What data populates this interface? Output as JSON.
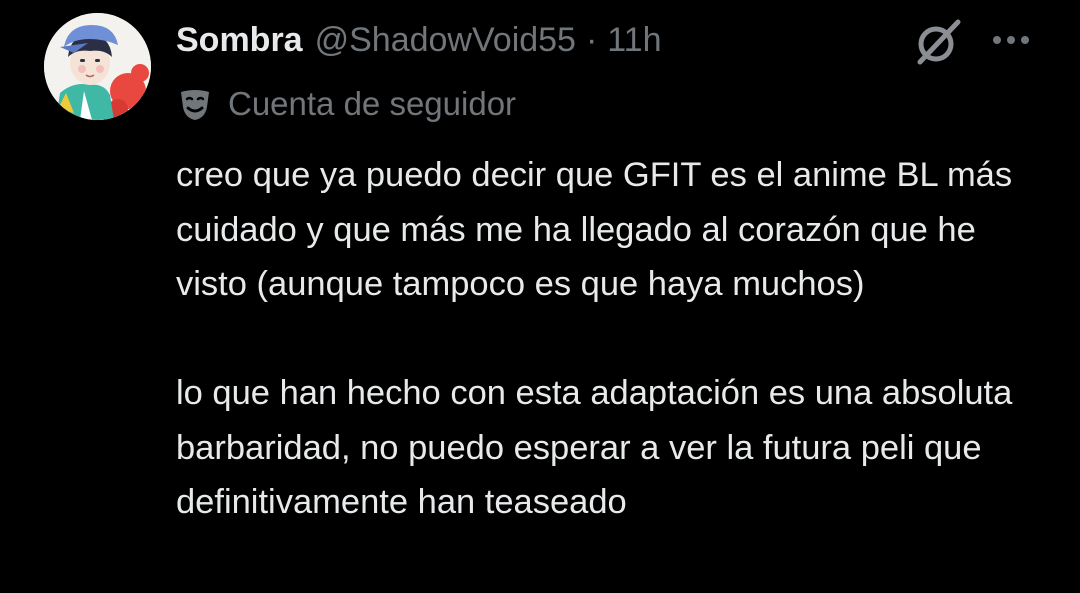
{
  "tweet": {
    "author": {
      "display_name": "Sombra",
      "handle": "@ShadowVoid55",
      "avatar_icon": "avatar-image"
    },
    "separator": "·",
    "timestamp": "11h",
    "label": {
      "icon": "theater-masks-icon",
      "text": "Cuenta de seguidor"
    },
    "actions": {
      "grok_icon": "grok-icon",
      "more_icon": "more-options-icon"
    },
    "body": {
      "paragraph_1": "creo que ya puedo decir que GFIT es el anime BL más cuidado y que más me ha llegado al corazón que he visto (aunque tampoco es que haya muchos)",
      "paragraph_2": "lo que han hecho con esta adaptación es una absoluta barbaridad, no puedo esperar a ver la futura peli que definitivamente han teaseado"
    }
  },
  "colors": {
    "background": "#000000",
    "primary_text": "#e7e9ea",
    "secondary_text": "#71767b"
  }
}
